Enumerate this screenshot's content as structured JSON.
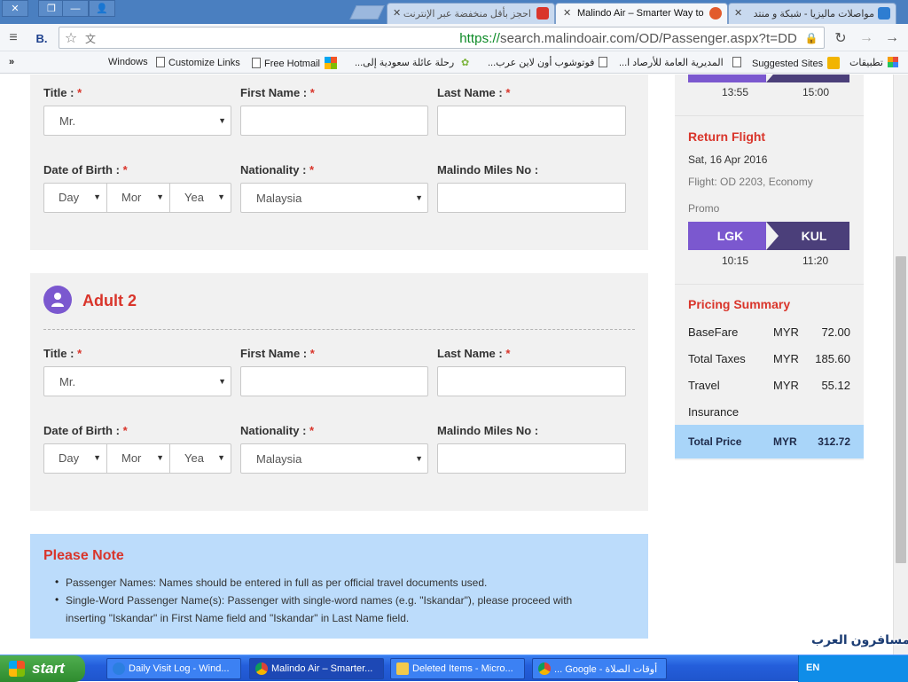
{
  "browser": {
    "tabs": [
      {
        "label": "مواصلات ماليزيا - شبكة و منتد"
      },
      {
        "label": "Malindo Air – Smarter Way to"
      },
      {
        "label": "احجز بأقل منخفضة عبر الإنترنت"
      }
    ],
    "url_scheme": "https://",
    "url_rest": "search.malindoair.com/OD/Passenger.aspx?t=DD",
    "bookmarks": [
      {
        "label": "تطبيقات"
      },
      {
        "label": "Suggested Sites"
      },
      {
        "label": "المديرية العامة للأرصاد ا..."
      },
      {
        "label": "فوتوشوب أون لاين عرب..."
      },
      {
        "label": "رحلة عائلة سعودية إلى..."
      },
      {
        "label": "Free Hotmail"
      },
      {
        "label": "Customize Links"
      },
      {
        "label": "Windows"
      }
    ],
    "overflow_label": "»"
  },
  "form": {
    "adult1": {
      "title_label": "Title :",
      "title_value": "Mr.",
      "first_name_label": "First Name :",
      "last_name_label": "Last Name :",
      "dob_label": "Date of Birth :",
      "dob_day": "Day",
      "dob_month": "Mor",
      "dob_year": "Yea",
      "nationality_label": "Nationality :",
      "nationality_value": "Malaysia",
      "miles_label": "Malindo Miles No :"
    },
    "adult2": {
      "heading": "Adult 2",
      "title_label": "Title :",
      "title_value": "Mr.",
      "first_name_label": "First Name :",
      "last_name_label": "Last Name :",
      "dob_label": "Date of Birth :",
      "dob_day": "Day",
      "dob_month": "Mor",
      "dob_year": "Yea",
      "nationality_label": "Nationality :",
      "nationality_value": "Malaysia",
      "miles_label": "Malindo Miles No :"
    },
    "required_mark": "*"
  },
  "note": {
    "heading": "Please Note",
    "items": [
      "Passenger Names: Names should be entered in full as per official travel documents used.",
      "Single-Word Passenger Name(s): Passenger with single-word names (e.g. \"Iskandar\"), please proceed with",
      "inserting \"Iskandar\" in First Name field and \"Iskandar\" in Last Name field."
    ]
  },
  "sidebar": {
    "depart_times": {
      "dep": "13:55",
      "arr": "15:00"
    },
    "return": {
      "heading": "Return Flight",
      "date": "Sat, 16 Apr 2016",
      "flight": "Flight: OD 2203, Economy",
      "fare_class": "Promo",
      "from": "LGK",
      "to": "KUL",
      "dep": "10:15",
      "arr": "11:20"
    },
    "pricing": {
      "heading": "Pricing Summary",
      "rows": [
        {
          "label": "BaseFare",
          "currency": "MYR",
          "amount": "72.00"
        },
        {
          "label": "Total Taxes",
          "currency": "MYR",
          "amount": "185.60"
        },
        {
          "label": "Travel",
          "currency": "MYR",
          "amount": "55.12"
        }
      ],
      "travel_suffix": "Insurance",
      "total_label": "Total Price",
      "total_currency": "MYR",
      "total_amount": "312.72"
    }
  },
  "taskbar": {
    "start": "start",
    "items": [
      {
        "label": "Daily Visit Log - Wind..."
      },
      {
        "label": "Malindo Air – Smarter..."
      },
      {
        "label": "Deleted Items - Micro..."
      },
      {
        "label": "أوقات الصلاة - Google ..."
      }
    ],
    "tray_lang": "EN",
    "watermark": "المسافرون العرب"
  },
  "colors": {
    "accent_red": "#d9352b",
    "route_purple": "#7b58cf",
    "route_dark": "#4b3f7a",
    "note_blue": "#bcdcfb",
    "total_blue": "#a9d5f9"
  }
}
